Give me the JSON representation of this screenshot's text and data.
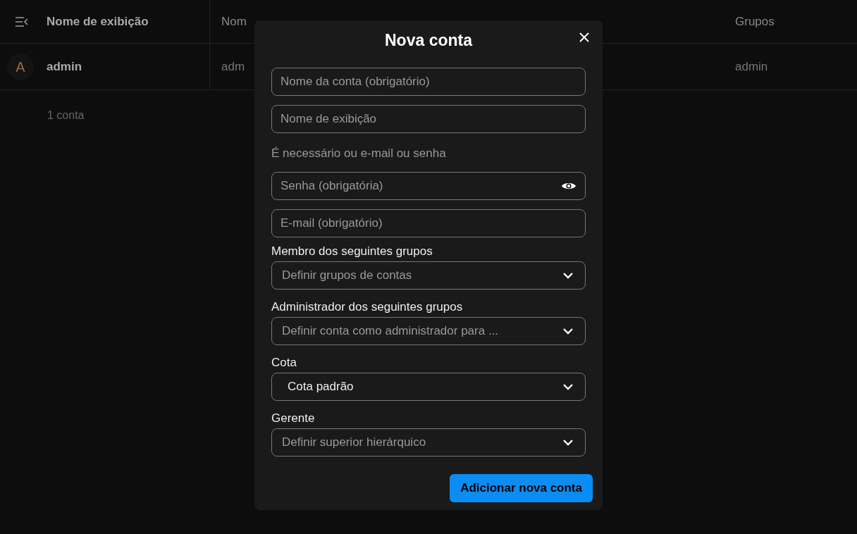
{
  "table": {
    "columns": [
      {
        "label": "Nome de exibição"
      },
      {
        "label": "Nom"
      },
      {},
      {},
      {
        "label": "Grupos"
      }
    ],
    "rows": [
      {
        "avatar": "A",
        "cells": [
          "admin",
          "adm",
          "",
          "",
          "admin"
        ]
      }
    ],
    "footer": "1 conta"
  },
  "dialog": {
    "title": "Nova conta",
    "items": [
      {
        "kind": "input",
        "placeholder": "Nome da conta (obrigatório)"
      },
      {
        "kind": "input",
        "placeholder": "Nome de exibição"
      },
      {
        "kind": "note",
        "text": "É necessário ou e-mail ou senha"
      },
      {
        "kind": "password",
        "placeholder": "Senha (obrigatória)"
      },
      {
        "kind": "input",
        "placeholder": "E-mail (obrigatório)"
      },
      {
        "kind": "select",
        "label": "Membro dos seguintes grupos",
        "placeholder": "Definir grupos de contas"
      },
      {
        "kind": "select",
        "label": "Administrador dos seguintes grupos",
        "placeholder": "Definir conta como administrador para ..."
      },
      {
        "kind": "select",
        "label": "Cota",
        "value": "Cota padrão"
      },
      {
        "kind": "select",
        "label": "Gerente",
        "placeholder": "Definir superior hierárquico"
      }
    ],
    "submit": "Adicionar nova conta"
  }
}
